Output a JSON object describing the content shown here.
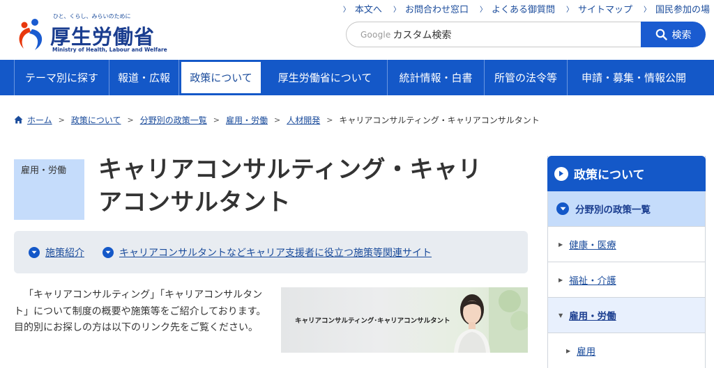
{
  "header": {
    "logo": {
      "tagline": "ひと、くらし、みらいのために",
      "name": "厚生労働省",
      "name_en": "Ministry of Health, Labour and Welfare"
    },
    "util_nav": [
      "本文へ",
      "お問合わせ窓口",
      "よくある御質問",
      "サイトマップ",
      "国民参加の場"
    ],
    "search": {
      "google_label": "Google",
      "placeholder": "カスタム検索",
      "button_label": "検索"
    }
  },
  "global_nav": {
    "items": [
      "テーマ別に探す",
      "報道・広報",
      "政策について",
      "厚生労働省について",
      "統計情報・白書",
      "所管の法令等",
      "申請・募集・情報公開"
    ],
    "active_index": 2
  },
  "breadcrumb": {
    "items": [
      "ホーム",
      "政策について",
      "分野別の政策一覧",
      "雇用・労働",
      "人材開発"
    ],
    "current": "キャリアコンサルティング・キャリアコンサルタント"
  },
  "main": {
    "category_tag": "雇用・労働",
    "title_line1": "キャリアコンサルティング・キャリ",
    "title_line2": "アコンサルタント",
    "anchors": [
      "施策紹介",
      "キャリアコンサルタントなどキャリア支援者に役立つ施策等関連サイト"
    ],
    "intro_text": "「キャリアコンサルティング」「キャリアコンサルタント」について制度の概要や施策等をご紹介しております。目的別にお探しの方は以下のリンク先をご覧ください。",
    "banner_text": "キャリアコンサルティング･キャリアコンサルタント"
  },
  "sidebar": {
    "heading": "政策について",
    "subheading": "分野別の政策一覧",
    "items": [
      "健康・医療",
      "福祉・介護",
      "雇用・労働",
      "雇用"
    ],
    "expanded_index": 2
  },
  "colors": {
    "primary": "#1458c8",
    "link": "#1a4b9b",
    "tag_bg": "#c5dcfb",
    "anchor_bg": "#e8ecf1"
  }
}
